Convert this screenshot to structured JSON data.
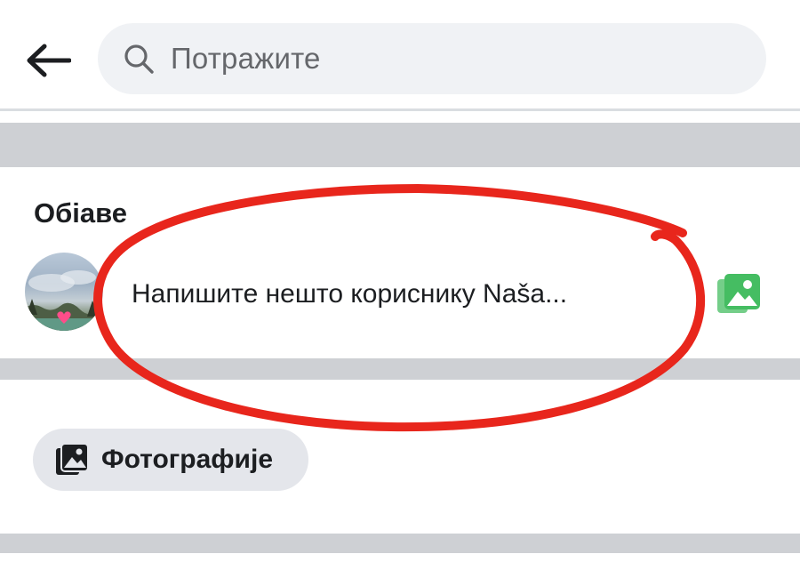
{
  "header": {
    "search_placeholder": "Потражите"
  },
  "posts_section": {
    "title": "Обіаве",
    "composer_prompt": "Напишите нешто кориснику Naša..."
  },
  "filters": {
    "photos_label": "Фотографије"
  },
  "colors": {
    "background": "#ffffff",
    "search_bg": "#f0f2f5",
    "divider_band": "#ced0d4",
    "photo_icon_green": "#45bd62",
    "annotation_red": "#e8261c",
    "chip_bg": "#e4e6eb"
  },
  "icons": {
    "back": "arrow-left-icon",
    "search": "search-icon",
    "photo": "photo-icon",
    "chip": "photo-stack-icon"
  }
}
